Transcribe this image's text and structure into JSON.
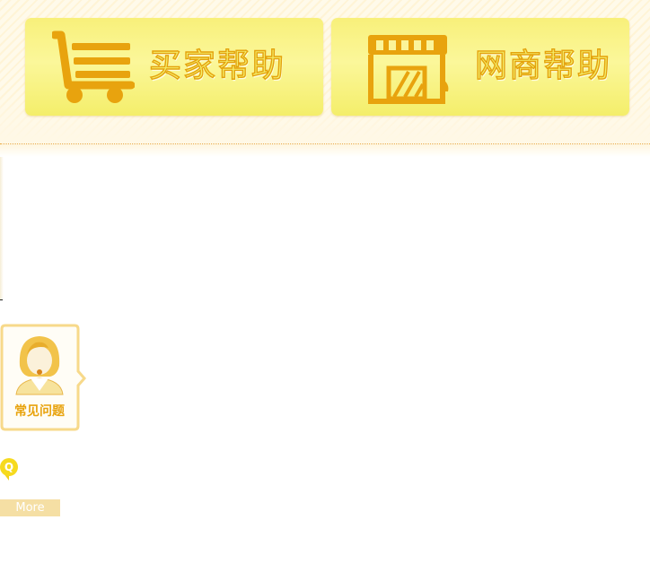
{
  "buyer_help": {
    "label": "买家帮助",
    "icon": "cart-icon"
  },
  "seller_help": {
    "label": "网商帮助",
    "icon": "store-icon"
  },
  "faq": {
    "label": "常见问题",
    "icon": "agent-avatar-icon"
  },
  "question_badge": {
    "text": "Q"
  },
  "more": {
    "label": "More"
  },
  "colors": {
    "accent": "#e8a30e",
    "button_yellow": "#f8f07a",
    "more_bg": "#f5dfa4"
  }
}
